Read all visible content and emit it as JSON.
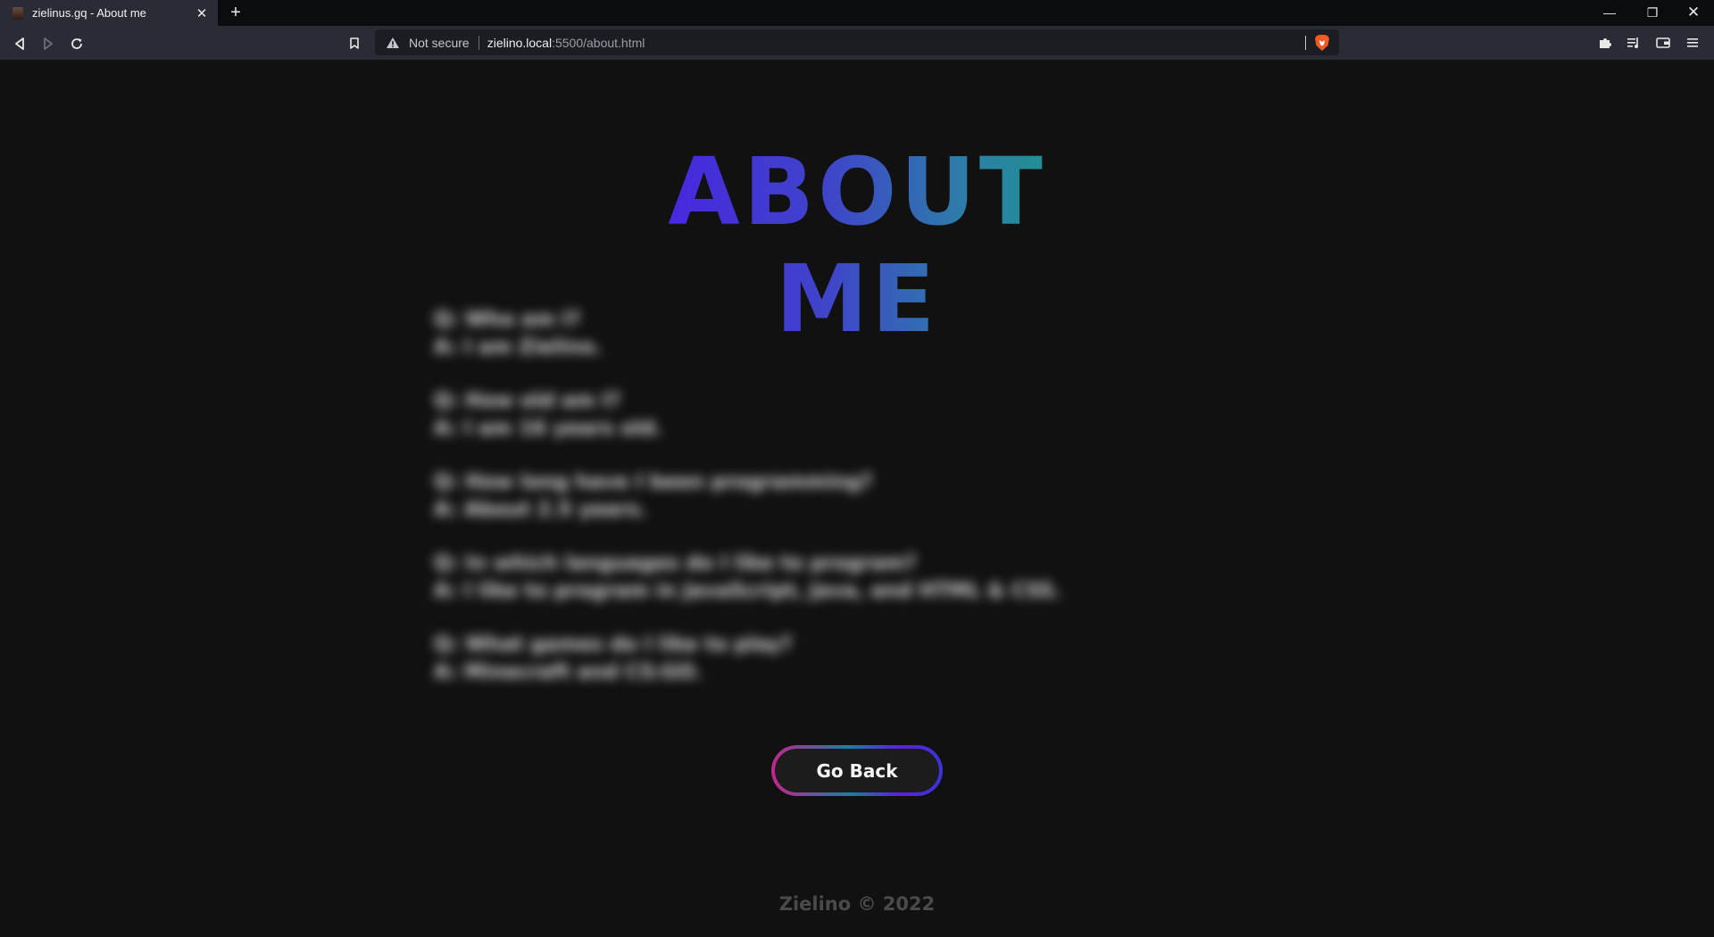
{
  "browser": {
    "tab": {
      "title": "zielinus.gq - About me",
      "close": "✕"
    },
    "new_tab": "+",
    "window": {
      "minimize": "—",
      "maximize": "❐",
      "close": "✕"
    },
    "nav": {
      "back": "◁",
      "forward": "▷",
      "reload": "↻"
    },
    "address": {
      "security": "Not secure",
      "host": "zielino.local",
      "path": ":5500/about.html"
    },
    "extensions": {
      "puzzle": "✦",
      "media": "≡",
      "wallet": "▭",
      "menu": "☰"
    }
  },
  "page": {
    "heading": "ABOUT ME",
    "qa": [
      {
        "q": "Q: Who am I?",
        "a": "A: I am Zielino."
      },
      {
        "q": "Q: How old am I?",
        "a": "A: I am 16 years old."
      },
      {
        "q": "Q: How long have I been programming?",
        "a": "A: About 2.5 years."
      },
      {
        "q": "Q: In which languages do I like to program?",
        "a": "A: I like to program in JavaScript, Java, and HTML & CSS."
      },
      {
        "q": "Q: What games do I like to play?",
        "a": "A: Minecraft and CS:GO."
      }
    ],
    "go_back_label": "Go Back",
    "footer": "Zielino © 2022"
  }
}
